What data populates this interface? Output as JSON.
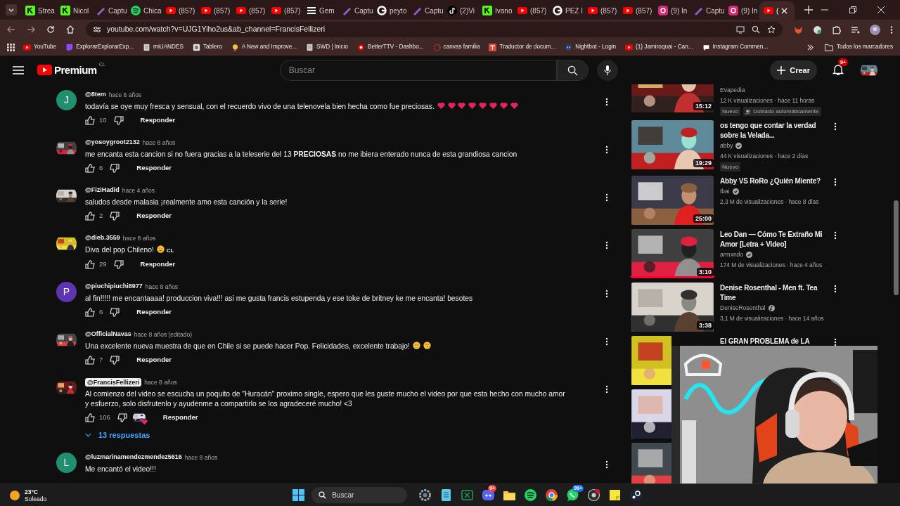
{
  "browser": {
    "tabs": [
      {
        "label": "Strea",
        "kind": "kick",
        "selected": false
      },
      {
        "label": "Nicol",
        "kind": "kick",
        "selected": false
      },
      {
        "label": "Captu",
        "kind": "pen",
        "selected": false
      },
      {
        "label": "Chica",
        "kind": "spotify",
        "selected": false
      },
      {
        "label": "(857)",
        "kind": "youtube",
        "selected": false
      },
      {
        "label": "(857)",
        "kind": "youtube",
        "selected": false
      },
      {
        "label": "(857)",
        "kind": "youtube",
        "selected": false
      },
      {
        "label": "(857)",
        "kind": "youtube",
        "selected": false
      },
      {
        "label": "Gem",
        "kind": "lines",
        "selected": false
      },
      {
        "label": "Captu",
        "kind": "pen",
        "selected": false
      },
      {
        "label": "peyto",
        "kind": "google",
        "selected": false
      },
      {
        "label": "Captu",
        "kind": "pen",
        "selected": false
      },
      {
        "label": "(2)Vi",
        "kind": "tiktok",
        "selected": false
      },
      {
        "label": "Ivano",
        "kind": "kick",
        "selected": false
      },
      {
        "label": "(857)",
        "kind": "youtube",
        "selected": false
      },
      {
        "label": "PEZ I",
        "kind": "google",
        "selected": false
      },
      {
        "label": "(857)",
        "kind": "youtube",
        "selected": false
      },
      {
        "label": "(857)",
        "kind": "youtube",
        "selected": false
      },
      {
        "label": "(9) In",
        "kind": "instagram",
        "selected": false
      },
      {
        "label": "Captu",
        "kind": "pen",
        "selected": false
      },
      {
        "label": "(9) In",
        "kind": "instagram",
        "selected": false
      },
      {
        "label": "(",
        "kind": "youtube",
        "selected": true
      }
    ],
    "address": "youtube.com/watch?v=UJG1Yiho2us&ab_channel=FrancisFellizeri",
    "bookmarks": [
      {
        "label": "YouTube",
        "kind": "youtube"
      },
      {
        "label": "ExplorarExplorarExp...",
        "kind": "twitch"
      },
      {
        "label": "miUANDES",
        "kind": "page"
      },
      {
        "label": "Tablero",
        "kind": "board"
      },
      {
        "label": "A New and Improve...",
        "kind": "bulb"
      },
      {
        "label": "SWD | Inicio",
        "kind": "page"
      },
      {
        "label": "BetterTTV - Dashbo...",
        "kind": "red-circle"
      },
      {
        "label": "canvas familia",
        "kind": "ring"
      },
      {
        "label": "Traductor de docum...",
        "kind": "translate"
      },
      {
        "label": "Nightbot - Login",
        "kind": "bot"
      },
      {
        "label": "(1) Jamiroquai - Can...",
        "kind": "youtube"
      },
      {
        "label": "Instagram Commen...",
        "kind": "bubble"
      }
    ],
    "all_bookmarks": "Todos los marcadores"
  },
  "header": {
    "logo": "Premium",
    "region": "CL",
    "search_placeholder": "Buscar",
    "create": "Crear",
    "notifications": "9+"
  },
  "comments": [
    {
      "avatar": {
        "kind": "letter",
        "letter": "J",
        "color": "#1f8f6f"
      },
      "author": "@8tem",
      "creator": false,
      "time": "hace 6 años",
      "text": "todavía se oye muy fresca y sensual, con el recuerdo vivo de una telenovela bien hecha como fue preciosas.",
      "emojis": [
        {
          "kind": "heart"
        },
        {
          "kind": "heart"
        },
        {
          "kind": "heart"
        },
        {
          "kind": "heart"
        },
        {
          "kind": "heart"
        },
        {
          "kind": "heart"
        },
        {
          "kind": "heart"
        },
        {
          "kind": "heart"
        }
      ],
      "likes": "10",
      "reply": "Responder",
      "creator_heart": false
    },
    {
      "avatar": {
        "kind": "picture"
      },
      "author": "@yosoygroot2132",
      "creator": false,
      "time": "hace 8 años",
      "text": "me encanta esta cancion si no fuera gracias a la teleserie del 13 **PRECIOSAS** no me ibiera enterado nunca de esta grandiosa cancion",
      "likes": "6",
      "reply": "Responder",
      "creator_heart": false
    },
    {
      "avatar": {
        "kind": "picture"
      },
      "author": "@FiziHadid",
      "creator": false,
      "time": "hace 4 años",
      "text": "saludos desde malasia ¡realmente amo esta canción y la serie!",
      "likes": "2",
      "reply": "Responder",
      "creator_heart": false
    },
    {
      "avatar": {
        "kind": "picture"
      },
      "author": "@dieb.3559",
      "creator": false,
      "time": "hace 8 años",
      "text": "Diva del pop Chileno!",
      "emojis": [
        {
          "kind": "heart-eyes"
        }
      ],
      "suffix": "CL",
      "likes": "29",
      "reply": "Responder",
      "creator_heart": false
    },
    {
      "avatar": {
        "kind": "letter",
        "letter": "P",
        "color": "#5e35b1"
      },
      "author": "@piuchipiuchi8977",
      "creator": false,
      "time": "hace 8 años",
      "text": "al fin!!!!! me encantaaaa! produccion viva!!! asi me gusta francis estupenda y ese toke de britney ke me encanta! besotes",
      "likes": "6",
      "reply": "Responder",
      "creator_heart": false
    },
    {
      "avatar": {
        "kind": "picture"
      },
      "author": "@OfficialNavas",
      "creator": false,
      "time": "hace 8 años (editado)",
      "text": "Una excelente nueva muestra de que en Chile si se puede hacer Pop. Felicidades, excelente trabajo!",
      "emojis": [
        {
          "kind": "grin"
        },
        {
          "kind": "kiss"
        }
      ],
      "likes": "7",
      "reply": "Responder",
      "creator_heart": false
    },
    {
      "avatar": {
        "kind": "picture"
      },
      "author": "@FrancisFellizeri",
      "creator": true,
      "time": "hace 8 años",
      "text": "Al comienzo del video se escucha un poquito de \"Huracán\" proximo single, espero que les guste mucho el video por que esta hecho con mucho amor y esfuerzo, solo disfrutenlo y ayudenme a compartirlo se los agradeceré mucho! <3",
      "likes": "106",
      "reply": "Responder",
      "creator_heart": true,
      "replies": "13 respuestas"
    },
    {
      "avatar": {
        "kind": "letter",
        "letter": "L",
        "color": "#1f8f6f"
      },
      "author": "@luzmarinamendezmendez5616",
      "creator": false,
      "time": "hace 8 años",
      "text": "Me encantó el video!!!",
      "creator_heart": false
    }
  ],
  "related": [
    {
      "kind": "video",
      "channel": "Evapedia",
      "meta": "12 K visualizaciones · hace 11 horas",
      "badges": [
        {
          "label": "Nuevo",
          "kind": "plain"
        },
        {
          "label": "Doblado automáticamente",
          "kind": "dubbed"
        }
      ],
      "duration": "15:12"
    },
    {
      "kind": "video",
      "title": "os tengo que contar la verdad sobre la Velada...",
      "channel": "abby",
      "channel_badge": {
        "kind": "check"
      },
      "meta": "44 K visualizaciones · hace 2 días",
      "badges": [
        {
          "label": "Nuevo",
          "kind": "plain"
        }
      ],
      "duration": "19:29"
    },
    {
      "kind": "video",
      "title": "Abby VS RoRo ¿Quién Miente?",
      "channel": "Ibai",
      "channel_badge": {
        "kind": "check"
      },
      "meta": "2,3 M de visualizaciones · hace 8 días",
      "duration": "25:00"
    },
    {
      "kind": "video",
      "title": "Leo Dan — Cómo Te Extraño Mi Amor [Letra + Video]",
      "channel": "armxndo",
      "channel_badge": {
        "kind": "check"
      },
      "meta": "174 M de visualizaciones · hace 4 años",
      "duration": "3:10",
      "level": 1
    },
    {
      "kind": "video",
      "title": "Denise Rosenthal - Men ft. Tea Time",
      "channel": "DeniseRosenthal",
      "channel_badge": {
        "kind": "music"
      },
      "meta": "3,1 M de visualizaciones · hace 14 años",
      "duration": "3:38"
    },
    {
      "kind": "video",
      "title": "El GRAN PROBLEMA de LA"
    },
    {
      "kind": "picture"
    },
    {
      "kind": "picture"
    }
  ],
  "taskbar": {
    "temperature": "23°C",
    "condition": "Soleado",
    "search_placeholder": "Buscar",
    "apps": [
      {
        "kind": "windows"
      },
      {
        "kind": "gear"
      },
      {
        "kind": "notepad"
      },
      {
        "kind": "sheet"
      },
      {
        "kind": "discord",
        "badge": "9+"
      },
      {
        "kind": "folder"
      },
      {
        "kind": "spotify"
      },
      {
        "kind": "chrome"
      },
      {
        "kind": "whatsapp",
        "badge": "99+"
      },
      {
        "kind": "record"
      },
      {
        "kind": "sticky"
      },
      {
        "kind": "steam"
      }
    ]
  }
}
